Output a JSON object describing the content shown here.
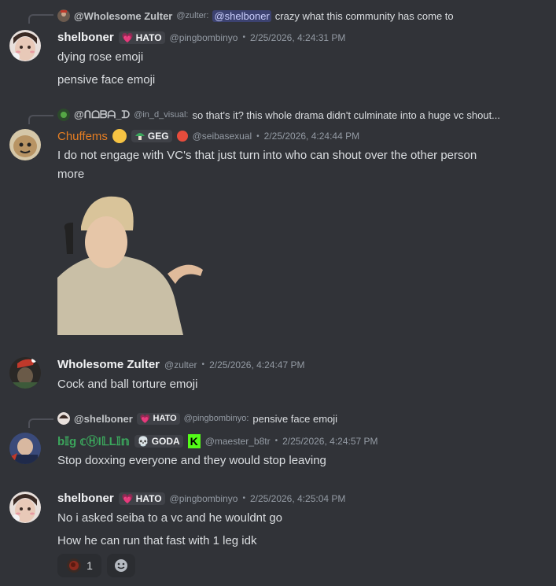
{
  "messages": [
    {
      "reply": {
        "name": "@Wholesome Zulter",
        "handle": "@zulter:",
        "mention": "@shelboner",
        "text": "crazy what this community has come to"
      },
      "author": "shelboner",
      "tag": "HATO",
      "handle": "@pingbombinyo",
      "dot": "•",
      "time": "2/25/2026, 4:24:31 PM",
      "lines": [
        "dying rose emoji",
        "pensive face emoji"
      ]
    },
    {
      "reply": {
        "name": "@ᑎᗝᗷᗩ_ᗪ",
        "handle": "@in_d_visual:",
        "text": "so that's it? this whole drama didn't culminate into a huge vc shout..."
      },
      "author": "Chuffems",
      "author_color": "#e67e22",
      "tag": "GEG",
      "handle": "@seibasexual",
      "dot": "•",
      "time": "2/25/2026, 4:24:44 PM",
      "lines": [
        "I do not engage with VC's that just turn into who can shout over the other person",
        "more"
      ]
    },
    {
      "author": "Wholesome Zulter",
      "handle": "@zulter",
      "dot": "•",
      "time": "2/25/2026, 4:24:47 PM",
      "lines": [
        "Cock and ball torture emoji"
      ]
    },
    {
      "reply": {
        "name": "@shelboner",
        "tag": "HATO",
        "handle": "@pingbombinyo:",
        "text": "pensive face emoji"
      },
      "author": "b𝕀g 𝕔ⒽI𝕃L𝕀𝕟",
      "author_color": "#3ba55c",
      "tag": "GODA",
      "handle": "@maester_b8tr",
      "dot": "•",
      "time": "2/25/2026, 4:24:57 PM",
      "lines": [
        "Stop doxxing everyone and they would stop leaving"
      ]
    },
    {
      "author": "shelboner",
      "tag": "HATO",
      "handle": "@pingbombinyo",
      "dot": "•",
      "time": "2/25/2026, 4:25:04 PM",
      "lines": [
        "No i asked seiba to a vc and he wouldnt go",
        "How he can run that fast with 1 leg idk"
      ],
      "reaction_count": "1"
    }
  ],
  "icons": {
    "heart": "heart-icon",
    "mushroom": "mushroom-icon",
    "skull": "skull-icon",
    "add_reaction": "add-reaction-icon"
  }
}
